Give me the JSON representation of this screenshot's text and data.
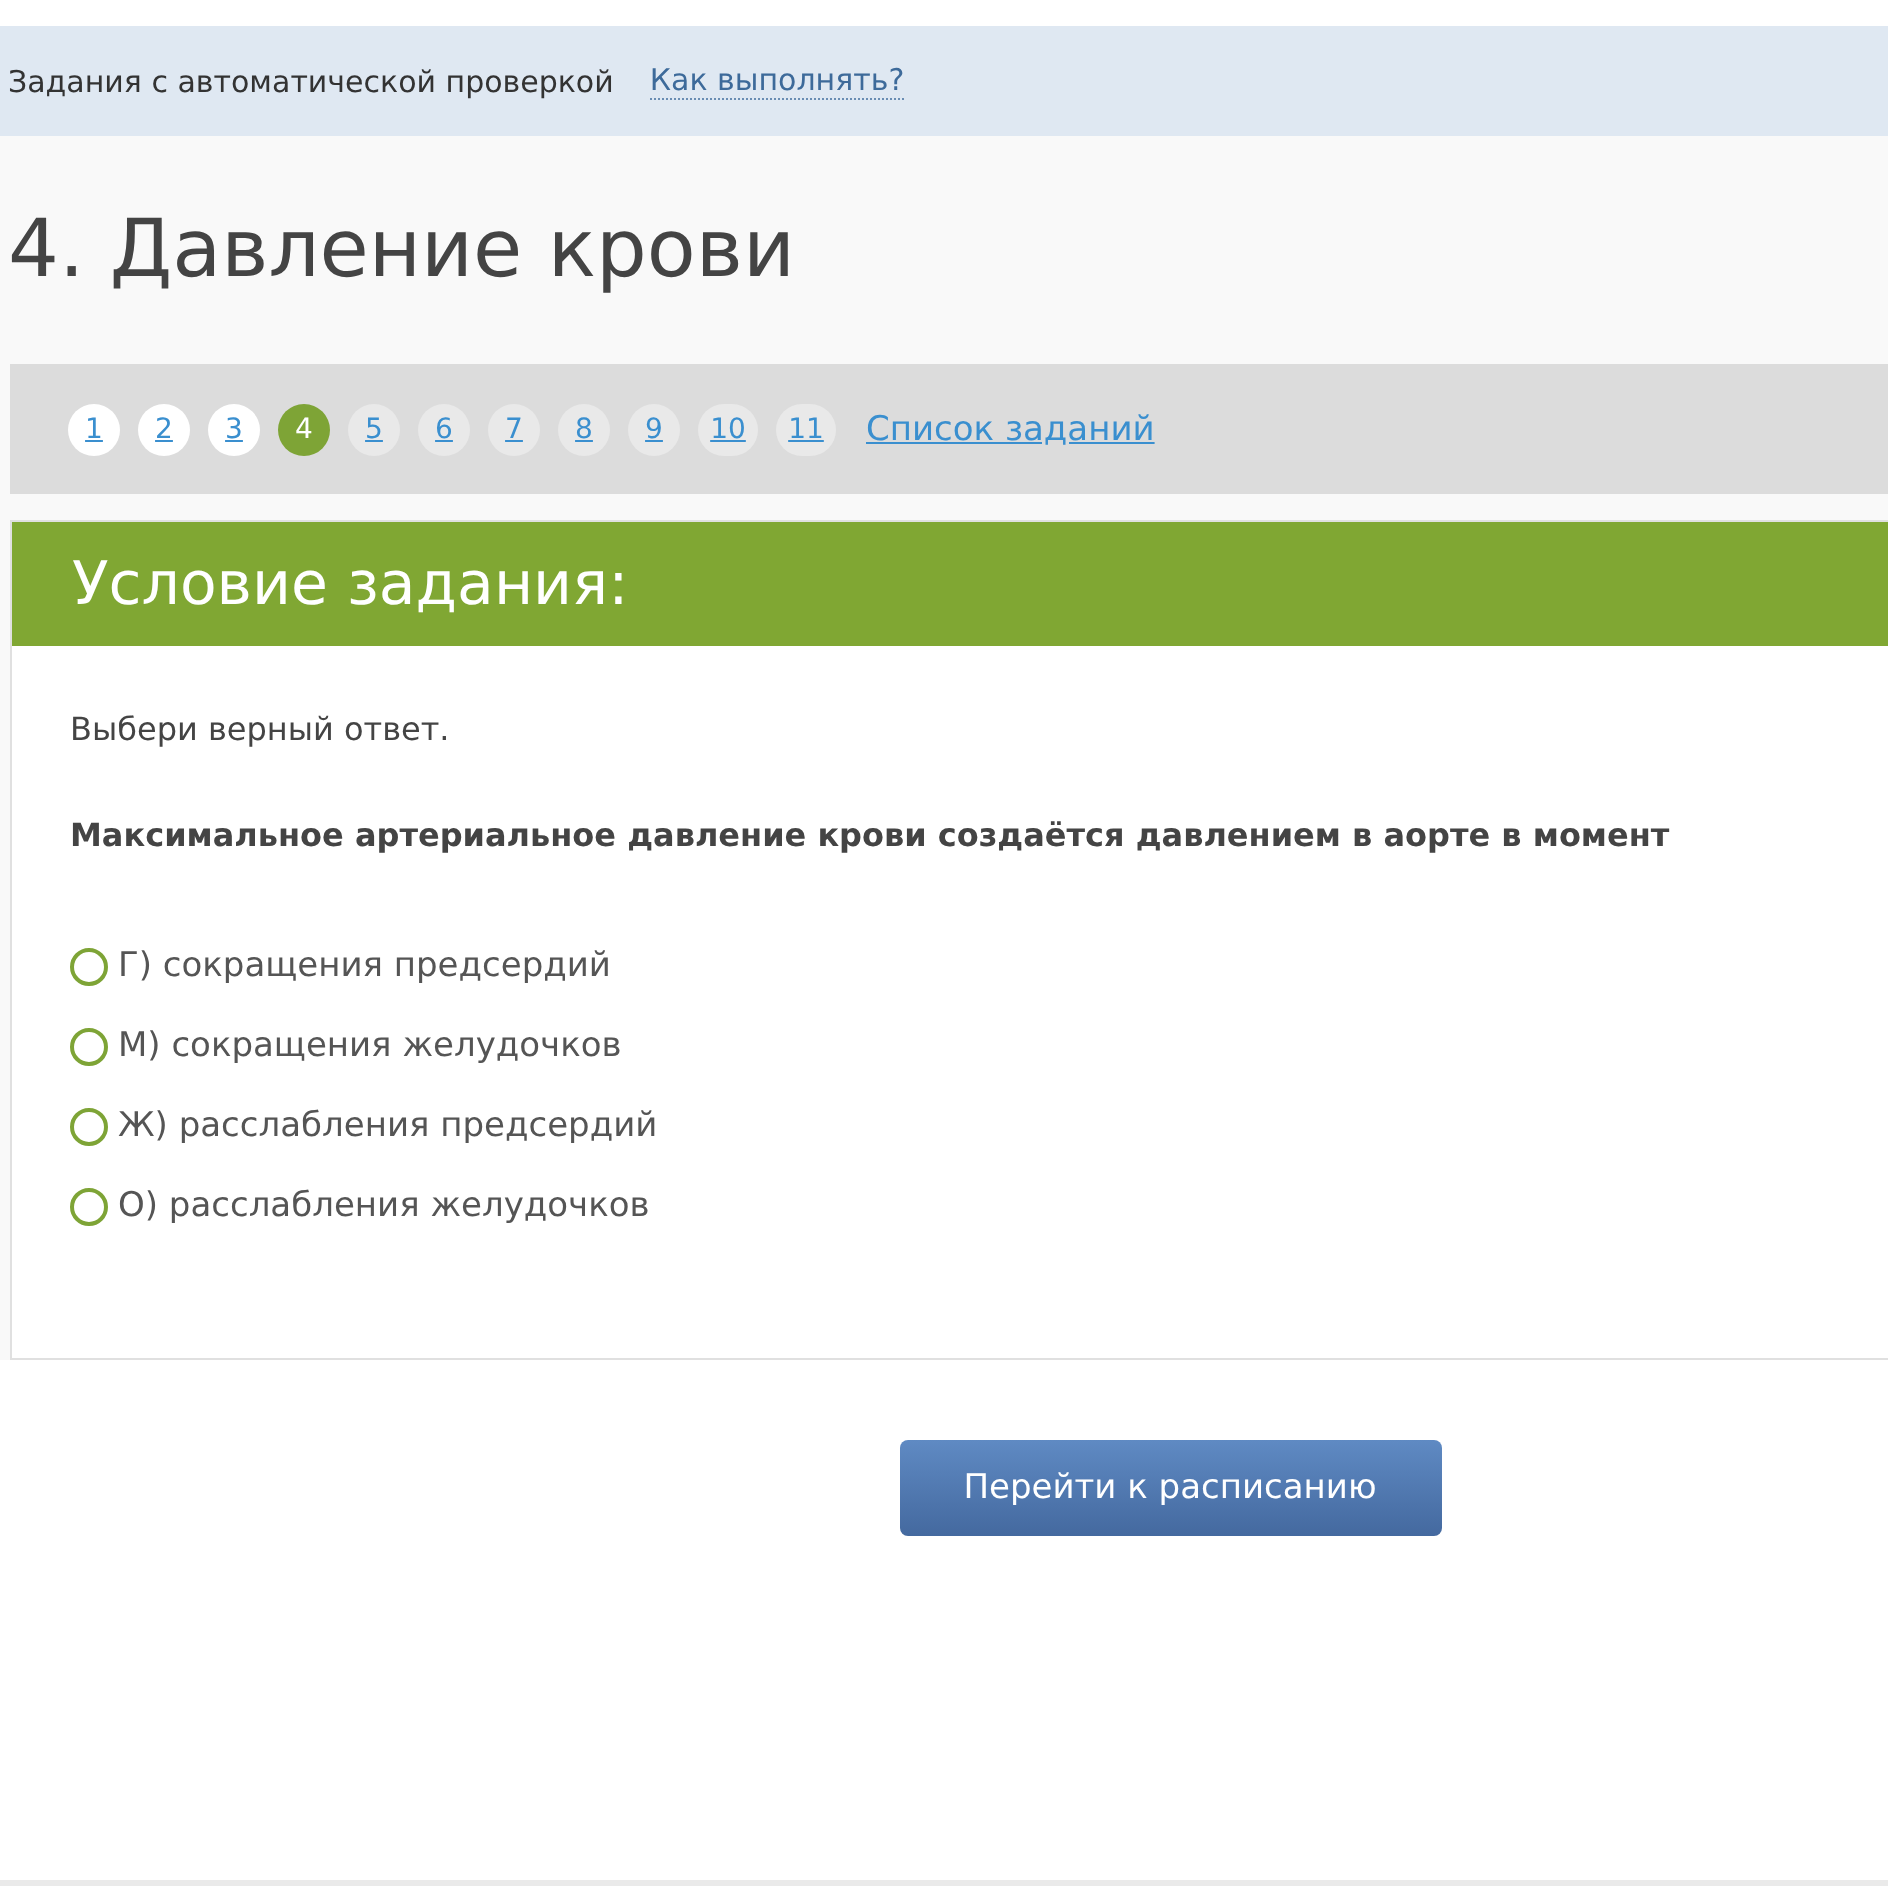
{
  "info_bar": {
    "label": "Задания с автоматической проверкой",
    "help_link": "Как выполнять?"
  },
  "title": "4. Давление крови",
  "pager": {
    "pages": [
      {
        "label": "1",
        "selected": false,
        "visited": true
      },
      {
        "label": "2",
        "selected": false,
        "visited": true
      },
      {
        "label": "3",
        "selected": false,
        "visited": true
      },
      {
        "label": "4",
        "selected": true,
        "visited": false
      },
      {
        "label": "5",
        "selected": false,
        "visited": false
      },
      {
        "label": "6",
        "selected": false,
        "visited": false
      },
      {
        "label": "7",
        "selected": false,
        "visited": false
      },
      {
        "label": "8",
        "selected": false,
        "visited": false
      },
      {
        "label": "9",
        "selected": false,
        "visited": false
      },
      {
        "label": "10",
        "selected": false,
        "visited": false
      },
      {
        "label": "11",
        "selected": false,
        "visited": false
      }
    ],
    "list_link": "Список заданий"
  },
  "task": {
    "heading": "Условие задания:",
    "instruction": "Выбери верный ответ.",
    "question": "Максимальное артериальное давление крови создаётся давлением в аорте в момент",
    "options": [
      {
        "label": "Г) сокращения предсердий",
        "selected": false
      },
      {
        "label": "М) сокращения желудочков",
        "selected": false
      },
      {
        "label": "Ж) расслабления предсердий",
        "selected": false
      },
      {
        "label": "О) расслабления желудочков",
        "selected": false
      }
    ]
  },
  "schedule_button": "Перейти к расписанию"
}
